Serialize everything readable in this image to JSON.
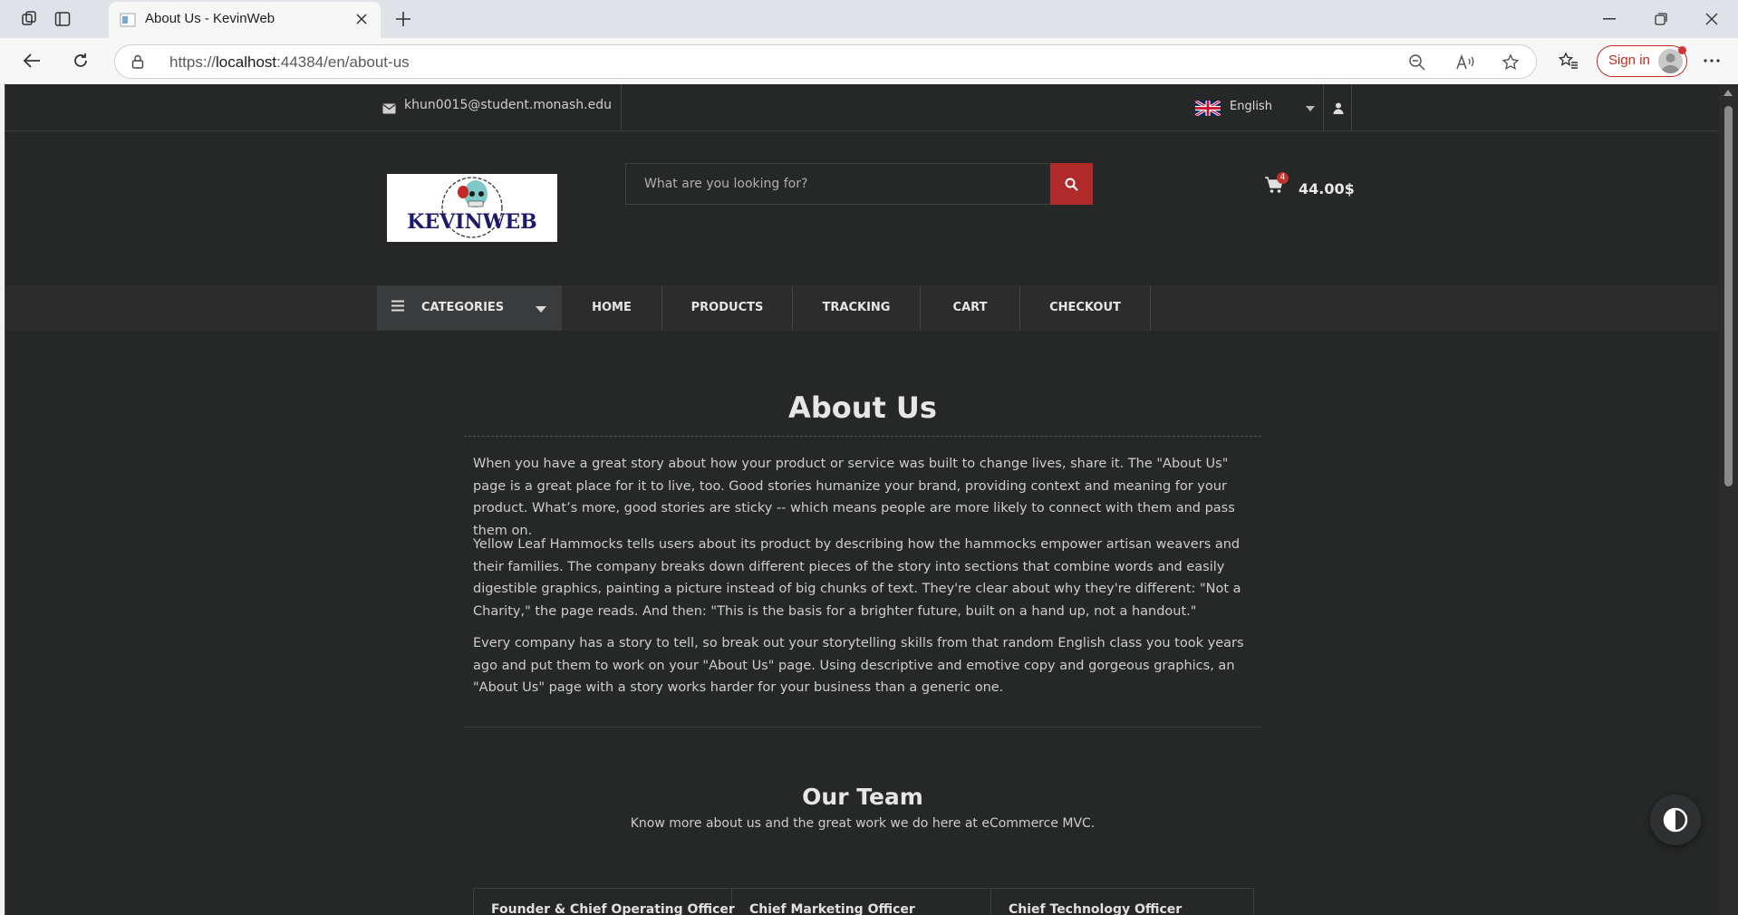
{
  "browser": {
    "tab_title": "About Us - KevinWeb",
    "url_prefix": "https://",
    "url_host": "localhost",
    "url_rest": ":44384/en/about-us",
    "sign_in_label": "Sign in"
  },
  "topbar": {
    "email": "khun0015@student.monash.edu",
    "language": "English"
  },
  "header": {
    "logo_alt": "KEVINWEB",
    "search_placeholder": "What are you looking for?",
    "cart_count": "4",
    "cart_total": "44.00$"
  },
  "nav": {
    "categories_label": "CATEGORIES",
    "items": [
      {
        "label": "HOME"
      },
      {
        "label": "PRODUCTS"
      },
      {
        "label": "TRACKING"
      },
      {
        "label": "CART"
      },
      {
        "label": "CHECKOUT"
      }
    ]
  },
  "about": {
    "title": "About Us",
    "paragraphs": [
      "When you have a great story about how your product or service was built to change lives, share it. The \"About Us\" page is a great place for it to live, too. Good stories humanize your brand, providing context and meaning for your product. What’s more, good stories are sticky -- which means people are more likely to connect with them and pass them on.",
      "Yellow Leaf Hammocks tells users about its product by describing how the hammocks empower artisan weavers and their families. The company breaks down different pieces of the story into sections that combine words and easily digestible graphics, painting a picture instead of big chunks of text. They're clear about why they're different: \"Not a Charity,\" the page reads. And then: \"This is the basis for a brighter future, built on a hand up, not a handout.\"",
      "Every company has a story to tell, so break out your storytelling skills from that random English class you took years ago and put them to work on your \"About Us\" page. Using descriptive and emotive copy and gorgeous graphics, an \"About Us\" page with a story works harder for your business than a generic one."
    ]
  },
  "team": {
    "title": "Our Team",
    "subtitle": "Know more about us and the great work we do here at eCommerce MVC.",
    "roles": [
      "Founder & Chief Operating Officer",
      "Chief Marketing Officer",
      "Chief Technology Officer"
    ]
  },
  "colors": {
    "page_bg": "#262727",
    "accent": "#b02a2a",
    "text": "#cdcdcd"
  }
}
